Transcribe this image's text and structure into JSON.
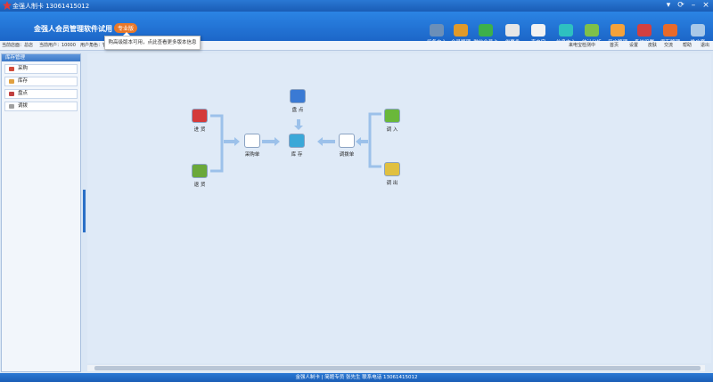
{
  "window": {
    "title": "金强人制卡 13061415012"
  },
  "header": {
    "app_title": "金强人会员管理软件试用",
    "edition": "专业版",
    "tip": "购高级版本可用，点此查看更多版本信息",
    "nav": [
      {
        "label": "设备中心",
        "color": "#6b8fb8"
      },
      {
        "label": "会员管理",
        "color": "#e09a2a"
      },
      {
        "label": "微信会员卡",
        "color": "#3db04a"
      },
      {
        "label": "优惠券",
        "color": "#e6e6e6"
      },
      {
        "label": "来电宝",
        "color": "#f2f2f2"
      },
      {
        "label": "信息中心",
        "color": "#2ec0c0"
      },
      {
        "label": "统计分析",
        "color": "#7ec04a"
      },
      {
        "label": "用户管理",
        "color": "#f4a23a"
      },
      {
        "label": "系统设置",
        "color": "#d24040"
      },
      {
        "label": "库存管理",
        "color": "#e86a2a"
      },
      {
        "label": "推广套",
        "color": "#a8c8e8"
      }
    ]
  },
  "infobar": {
    "store": "当前店面：总店",
    "user": "当前用户：10000",
    "role": "用户角色：管理员",
    "right_items": [
      "来电宝检测中",
      "首页",
      "设置",
      "皮肤",
      "交流",
      "帮助",
      "退出"
    ]
  },
  "sidebar": {
    "title": "库存管理",
    "items": [
      {
        "label": "采购",
        "color": "#d04a3a"
      },
      {
        "label": "库存",
        "color": "#e0a040"
      },
      {
        "label": "盘点",
        "color": "#c04040"
      },
      {
        "label": "调拨",
        "color": "#a0a0a0"
      }
    ]
  },
  "flow": {
    "jinhuo": "进 货",
    "tuihuo": "退 货",
    "caigoudan": "采购单",
    "pandian": "盘 点",
    "kucun": "库 存",
    "diaobodan": "调拨单",
    "diaoru": "调 入",
    "diaochu": "调 出"
  },
  "footer": {
    "text": "金强人制卡 | 简题专员  张先生 联系电话 13061415012"
  }
}
